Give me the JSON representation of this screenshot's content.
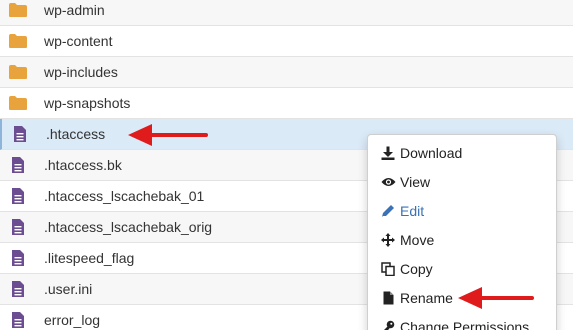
{
  "files": [
    {
      "name": "wp-admin",
      "icon": "folder-icon"
    },
    {
      "name": "wp-content",
      "icon": "folder-icon"
    },
    {
      "name": "wp-includes",
      "icon": "folder-icon"
    },
    {
      "name": "wp-snapshots",
      "icon": "folder-icon"
    },
    {
      "name": ".htaccess",
      "icon": "file-icon"
    },
    {
      "name": ".htaccess.bk",
      "icon": "file-icon"
    },
    {
      "name": ".htaccess_lscachebak_01",
      "icon": "file-icon"
    },
    {
      "name": ".htaccess_lscachebak_orig",
      "icon": "file-icon"
    },
    {
      "name": ".litespeed_flag",
      "icon": "file-icon"
    },
    {
      "name": ".user.ini",
      "icon": "file-icon"
    },
    {
      "name": "error_log",
      "icon": "file-icon"
    }
  ],
  "selected_file": ".htaccess",
  "context_menu": {
    "items": [
      {
        "label": "Download",
        "icon": "download-icon"
      },
      {
        "label": "View",
        "icon": "eye-icon"
      },
      {
        "label": "Edit",
        "icon": "pencil-icon"
      },
      {
        "label": "Move",
        "icon": "move-icon"
      },
      {
        "label": "Copy",
        "icon": "copy-icon"
      },
      {
        "label": "Rename",
        "icon": "file-icon"
      },
      {
        "label": "Change Permissions",
        "icon": "key-icon"
      }
    ]
  },
  "colors": {
    "folder": "#e8a33d",
    "file": "#6d4d91",
    "selected_row": "#dbeaf7",
    "annotation_arrow": "#e01b1b",
    "edit_link": "#3a72b5"
  }
}
